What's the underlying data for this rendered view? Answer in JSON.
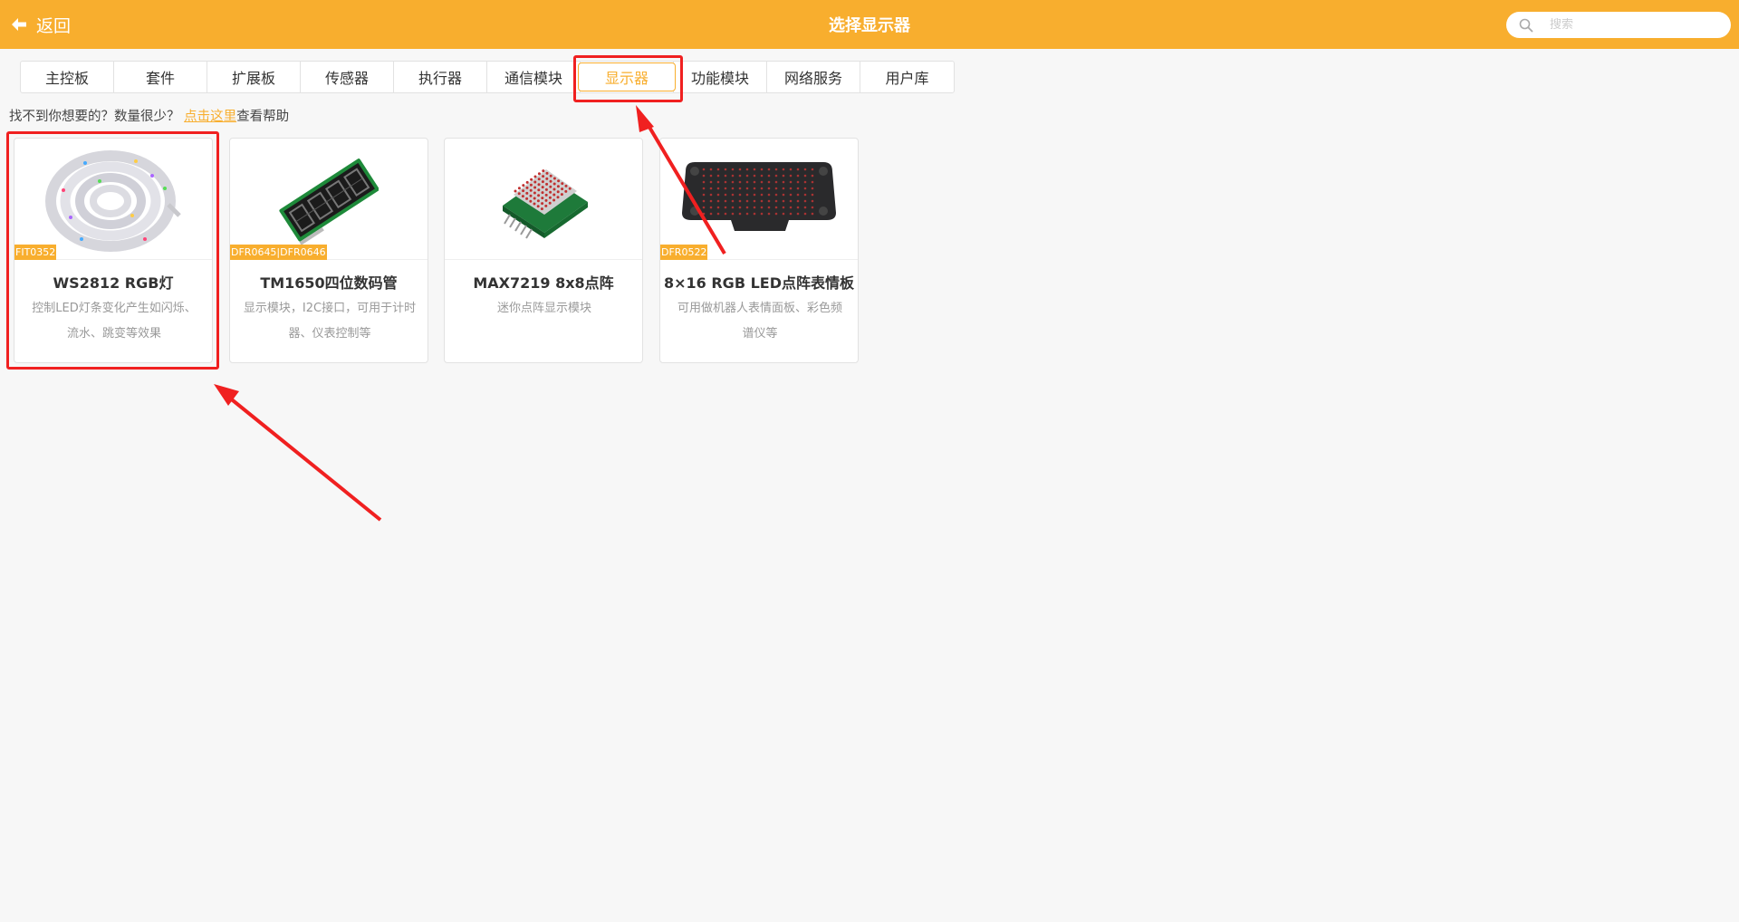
{
  "header": {
    "back_label": "返回",
    "title": "选择显示器",
    "search_placeholder": "搜索",
    "color": "#f8ae2e"
  },
  "tabs": [
    {
      "label": "主控板",
      "active": false
    },
    {
      "label": "套件",
      "active": false
    },
    {
      "label": "扩展板",
      "active": false
    },
    {
      "label": "传感器",
      "active": false
    },
    {
      "label": "执行器",
      "active": false
    },
    {
      "label": "通信模块",
      "active": false
    },
    {
      "label": "显示器",
      "active": true
    },
    {
      "label": "功能模块",
      "active": false
    },
    {
      "label": "网络服务",
      "active": false
    },
    {
      "label": "用户库",
      "active": false
    }
  ],
  "help": {
    "prefix": "找不到你想要的？数量很少？ ",
    "link": "点击这里",
    "suffix": "查看帮助"
  },
  "cards": [
    {
      "code": "FIT0352",
      "name": "WS2812 RGB灯",
      "desc": "控制LED灯条变化产生如闪烁、流水、跳变等效果",
      "image": "led-strip"
    },
    {
      "code": "DFR0645|DFR0646",
      "name": "TM1650四位数码管",
      "desc": "显示模块，I2C接口，可用于计时器、仪表控制等",
      "image": "seven-segment-display"
    },
    {
      "code": "",
      "name": "MAX7219 8x8点阵",
      "desc": "迷你点阵显示模块",
      "image": "dot-matrix"
    },
    {
      "code": "DFR0522",
      "name": "8×16 RGB LED点阵表情板",
      "desc": "可用做机器人表情面板、彩色频谱仪等",
      "image": "led-expression-panel"
    }
  ],
  "annotations": {
    "highlight_color": "#f02020"
  }
}
